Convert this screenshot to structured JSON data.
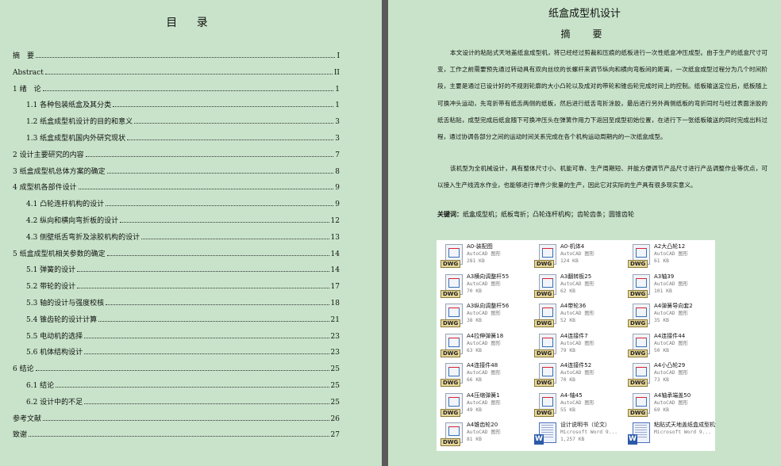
{
  "toc": {
    "title": "目  录",
    "entries": [
      {
        "label": "摘　要",
        "page": "I",
        "level": 1
      },
      {
        "label": "Abstract",
        "page": "II",
        "level": 1
      },
      {
        "label": "1 绪　论",
        "page": "1",
        "level": 1
      },
      {
        "label": "1.1 各种包装纸盒及其分类",
        "page": "1",
        "level": 2
      },
      {
        "label": "1.2 纸盒成型机设计的目的和意义",
        "page": "3",
        "level": 2
      },
      {
        "label": "1.3 纸盒成型机国内外研究现状",
        "page": "3",
        "level": 2
      },
      {
        "label": "2 设计主要研究的内容",
        "page": "7",
        "level": 1
      },
      {
        "label": "3 纸盒成型机总体方案的确定",
        "page": "8",
        "level": 1
      },
      {
        "label": "4 成型机各部件设计",
        "page": "9",
        "level": 1
      },
      {
        "label": "4.1 凸轮连杆机构的设计",
        "page": "9",
        "level": 2
      },
      {
        "label": "4.2 纵向和横向弯折板的设计",
        "page": "12",
        "level": 2
      },
      {
        "label": "4.3 侧壁纸舌弯折及涂胶机构的设计",
        "page": "13",
        "level": 2
      },
      {
        "label": "5 纸盒成型机相关参数的确定",
        "page": "14",
        "level": 1
      },
      {
        "label": "5.1 弹簧的设计",
        "page": "14",
        "level": 2
      },
      {
        "label": "5.2 带轮的设计",
        "page": "17",
        "level": 2
      },
      {
        "label": "5.3 轴的设计与强度校核",
        "page": "18",
        "level": 2
      },
      {
        "label": "5.4 锥齿轮的设计计算",
        "page": "21",
        "level": 2
      },
      {
        "label": "5.5 电动机的选择",
        "page": "23",
        "level": 2
      },
      {
        "label": "5.6 机体结构设计",
        "page": "23",
        "level": 2
      },
      {
        "label": "6 结论",
        "page": "25",
        "level": 1
      },
      {
        "label": "6.1 结论",
        "page": "25",
        "level": 2
      },
      {
        "label": "6.2 设计中的不足",
        "page": "25",
        "level": 2
      },
      {
        "label": "参考文献",
        "page": "26",
        "level": 1
      },
      {
        "label": "致谢",
        "page": "27",
        "level": 1
      }
    ]
  },
  "abstract_page": {
    "title": "纸盒成型机设计",
    "heading": "摘　要",
    "para1": "本文设计的粘贴式天地盖纸盒成型机，将已经经过剪裁和压痕的纸板进行一次性纸盒冲压成型。由于生产的纸盒尺寸可变，工作之前需要预先通过转动具有双向丝纹的长螺杆来调节纵向和横向弯板间的距离，一次纸盒成型过程分为几个时间阶段，主要是通过已设计好的不规则轮廓的大小凸轮以及成对的带轮和锥齿轮完成时间上的控制。纸板输送定位后，纸板随上可换冲头运动，先弯折带有纸舌两侧的纸板，然后进行纸舌弯折涂胶，最后进行另外两侧纸板的弯折同时与经过表面涂胶的纸舌粘贴，成型完成后纸盒随下可换冲压头在弹簧作用力下返回至成型初始位置，在进行下一张纸板输送的同时完成出料过程，通过协调各部分之间的运动时间关系完成在各个机构运动周期内的一次纸盒成型。",
    "para2": "该机型为全机械设计，具有整体尺寸小、机能可靠、生产周期短、并能方便调节产品尺寸进行产品调整作业等优点，可以接入生产线流水作业，也能够进行单件少批量的生产，因此它对实际的生产具有很多现实意义。",
    "keywords_label": "关键词：",
    "keywords": "纸盒成型机；纸板弯折；凸轮连杆机构；齿轮齿条；圆锥齿轮"
  },
  "files": [
    {
      "name": "A0-装配图",
      "type": "AutoCAD 图形",
      "size": "281 KB",
      "icon": "dwg-icon"
    },
    {
      "name": "A0-机体4",
      "type": "AutoCAD 图形",
      "size": "124 KB",
      "icon": "dwg-icon"
    },
    {
      "name": "A2大凸轮12",
      "type": "AutoCAD 图形",
      "size": "61 KB",
      "icon": "dwg-icon"
    },
    {
      "name": "A3横向调整杆55",
      "type": "AutoCAD 图形",
      "size": "70 KB",
      "icon": "dwg-icon"
    },
    {
      "name": "A3翻转板25",
      "type": "AutoCAD 图形",
      "size": "62 KB",
      "icon": "dwg-icon"
    },
    {
      "name": "A3轴39",
      "type": "AutoCAD 图形",
      "size": "101 KB",
      "icon": "dwg-icon"
    },
    {
      "name": "A3纵向调整杆56",
      "type": "AutoCAD 图形",
      "size": "38 KB",
      "icon": "dwg-icon"
    },
    {
      "name": "A4带轮36",
      "type": "AutoCAD 图形",
      "size": "52 KB",
      "icon": "dwg-icon"
    },
    {
      "name": "A4弹簧导向套2",
      "type": "AutoCAD 图形",
      "size": "35 KB",
      "icon": "dwg-icon"
    },
    {
      "name": "A4拉伸弹簧18",
      "type": "AutoCAD 图形",
      "size": "63 KB",
      "icon": "dwg-icon"
    },
    {
      "name": "A4连接件7",
      "type": "AutoCAD 图形",
      "size": "79 KB",
      "icon": "dwg-icon"
    },
    {
      "name": "A4连接件44",
      "type": "AutoCAD 图形",
      "size": "50 KB",
      "icon": "dwg-icon"
    },
    {
      "name": "A4连接件48",
      "type": "AutoCAD 图形",
      "size": "66 KB",
      "icon": "dwg-icon"
    },
    {
      "name": "A4连接件52",
      "type": "AutoCAD 图形",
      "size": "70 KB",
      "icon": "dwg-icon"
    },
    {
      "name": "A4小凸轮29",
      "type": "AutoCAD 图形",
      "size": "73 KB",
      "icon": "dwg-icon"
    },
    {
      "name": "A4压缩弹簧1",
      "type": "AutoCAD 图形",
      "size": "49 KB",
      "icon": "dwg-icon"
    },
    {
      "name": "A4-轴45",
      "type": "AutoCAD 图形",
      "size": "55 KB",
      "icon": "dwg-icon"
    },
    {
      "name": "A4轴承端盖50",
      "type": "AutoCAD 图形",
      "size": "69 KB",
      "icon": "dwg-icon"
    },
    {
      "name": "A4锥齿轮20",
      "type": "AutoCAD 图形",
      "size": "81 KB",
      "icon": "dwg-icon"
    },
    {
      "name": "设计说明书（论文）",
      "type": "Microsoft Word 9...",
      "size": "1,257 KB",
      "icon": "word-doc-icon"
    },
    {
      "name": "粘贴式天地盖纸盒成型机设计",
      "type": "Microsoft Word 9...",
      "size": "",
      "icon": "word-doc-icon"
    }
  ]
}
